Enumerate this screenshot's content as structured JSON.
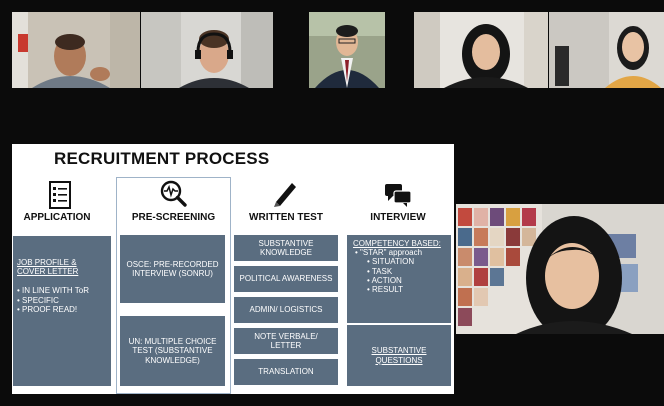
{
  "slide": {
    "title": "RECRUITMENT PROCESS",
    "columns": [
      {
        "heading": "APPLICATION",
        "icon": "checklist-icon",
        "box": {
          "title": "JOB PROFILE & COVER LETTER",
          "bullets": [
            "IN LINE WITH ToR",
            "SPECIFIC",
            "PROOF READ!"
          ]
        }
      },
      {
        "heading": "PRE-SCREENING",
        "icon": "magnifier-pulse-icon",
        "boxes": [
          "OSCE: PRE-RECORDED INTERVIEW (SONRU)",
          "UN: MULTIPLE CHOICE TEST (SUBSTANTIVE KNOWLEDGE)"
        ]
      },
      {
        "heading": "WRITTEN TEST",
        "icon": "pencil-icon",
        "boxes": [
          "SUBSTANTIVE KNOWLEDGE",
          "POLITICAL AWARENESS",
          "ADMIN/ LOGISTICS",
          "NOTE VERBALE/ LETTER",
          "TRANSLATION"
        ]
      },
      {
        "heading": "INTERVIEW",
        "icon": "speech-bubbles-icon",
        "box": {
          "title": "COMPETENCY BASED:",
          "star": "\"STAR\" approach",
          "items": [
            "SITUATION",
            "TASK",
            "ACTION",
            "RESULT"
          ]
        },
        "box2": "SUBSTANTIVE QUESTIONS"
      }
    ]
  }
}
